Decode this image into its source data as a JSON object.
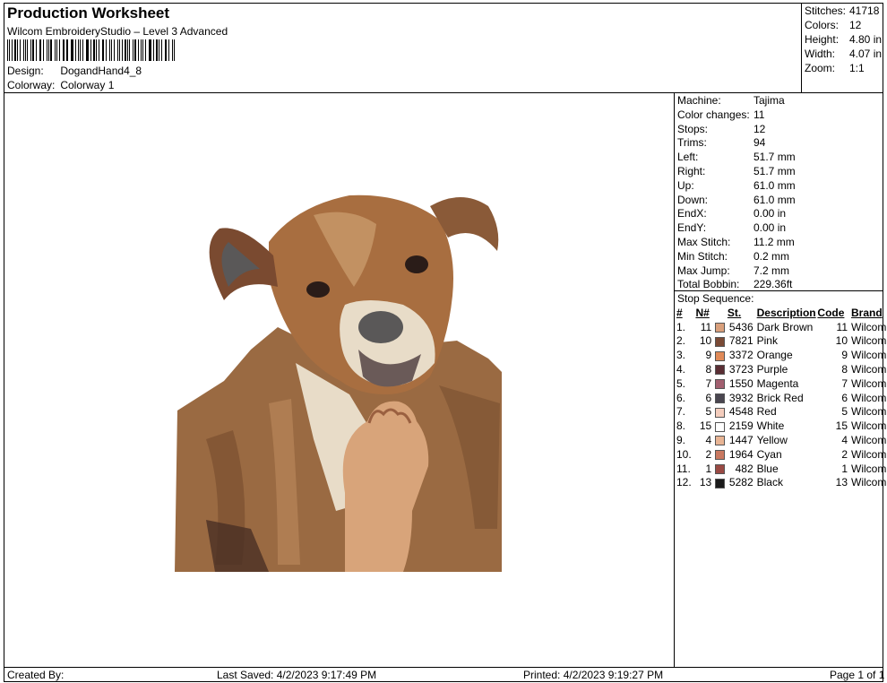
{
  "header": {
    "title": "Production Worksheet",
    "subtitle": "Wilcom EmbroideryStudio – Level 3 Advanced",
    "design_label": "Design:",
    "design_value": "DogandHand4_8",
    "colorway_label": "Colorway:",
    "colorway_value": "Colorway 1"
  },
  "top_stats": [
    {
      "label": "Stitches:",
      "value": "41718"
    },
    {
      "label": "Colors:",
      "value": "12"
    },
    {
      "label": "Height:",
      "value": "4.80 in"
    },
    {
      "label": "Width:",
      "value": "4.07 in"
    },
    {
      "label": "Zoom:",
      "value": "1:1"
    }
  ],
  "machine_info": [
    {
      "label": "Machine:",
      "value": "Tajima"
    },
    {
      "label": "Color changes:",
      "value": "11"
    },
    {
      "label": "Stops:",
      "value": "12"
    },
    {
      "label": "Trims:",
      "value": "94"
    },
    {
      "label": "Left:",
      "value": "51.7 mm"
    },
    {
      "label": "Right:",
      "value": "51.7 mm"
    },
    {
      "label": "Up:",
      "value": "61.0 mm"
    },
    {
      "label": "Down:",
      "value": "61.0 mm"
    },
    {
      "label": "EndX:",
      "value": "0.00 in"
    },
    {
      "label": "EndY:",
      "value": "0.00 in"
    },
    {
      "label": "Max Stitch:",
      "value": "11.2 mm"
    },
    {
      "label": "Min Stitch:",
      "value": "0.2 mm"
    },
    {
      "label": "Max Jump:",
      "value": "7.2 mm"
    },
    {
      "label": "Total Bobbin:",
      "value": "229.36ft"
    }
  ],
  "stop_sequence": {
    "title": "Stop Sequence:",
    "headers": [
      "#",
      "N#",
      "St.",
      "Description",
      "Code",
      "Brand"
    ],
    "rows": [
      {
        "idx": "1.",
        "n": "11",
        "color": "#d9a07c",
        "st": "5436",
        "desc": "Dark Brown",
        "code": "11",
        "brand": "Wilcom"
      },
      {
        "idx": "2.",
        "n": "10",
        "color": "#7a4a35",
        "st": "7821",
        "desc": "Pink",
        "code": "10",
        "brand": "Wilcom"
      },
      {
        "idx": "3.",
        "n": "9",
        "color": "#e08a58",
        "st": "3372",
        "desc": "Orange",
        "code": "9",
        "brand": "Wilcom"
      },
      {
        "idx": "4.",
        "n": "8",
        "color": "#5a2e34",
        "st": "3723",
        "desc": "Purple",
        "code": "8",
        "brand": "Wilcom"
      },
      {
        "idx": "5.",
        "n": "7",
        "color": "#a26070",
        "st": "1550",
        "desc": "Magenta",
        "code": "7",
        "brand": "Wilcom"
      },
      {
        "idx": "6.",
        "n": "6",
        "color": "#4a4650",
        "st": "3932",
        "desc": "Brick Red",
        "code": "6",
        "brand": "Wilcom"
      },
      {
        "idx": "7.",
        "n": "5",
        "color": "#f4cdbd",
        "st": "4548",
        "desc": "Red",
        "code": "5",
        "brand": "Wilcom"
      },
      {
        "idx": "8.",
        "n": "15",
        "color": "#ffffff",
        "st": "2159",
        "desc": "White",
        "code": "15",
        "brand": "Wilcom"
      },
      {
        "idx": "9.",
        "n": "4",
        "color": "#e8b494",
        "st": "1447",
        "desc": "Yellow",
        "code": "4",
        "brand": "Wilcom"
      },
      {
        "idx": "10.",
        "n": "2",
        "color": "#c87860",
        "st": "1964",
        "desc": "Cyan",
        "code": "2",
        "brand": "Wilcom"
      },
      {
        "idx": "11.",
        "n": "1",
        "color": "#9a4a44",
        "st": "482",
        "desc": "Blue",
        "code": "1",
        "brand": "Wilcom"
      },
      {
        "idx": "12.",
        "n": "13",
        "color": "#1a1a1a",
        "st": "5282",
        "desc": "Black",
        "code": "13",
        "brand": "Wilcom"
      }
    ]
  },
  "footer": {
    "created_by": "Created By:",
    "last_saved": "Last Saved: 4/2/2023 9:17:49 PM",
    "printed": "Printed: 4/2/2023 9:19:27 PM",
    "page": "Page 1 of 1"
  },
  "colors": {
    "fur_main": "#9a6a42",
    "fur_light": "#c89a6a",
    "fur_dark": "#4a3024",
    "chest": "#e8dcc8",
    "hand": "#d8a47a",
    "muzzle": "#5a5858"
  }
}
